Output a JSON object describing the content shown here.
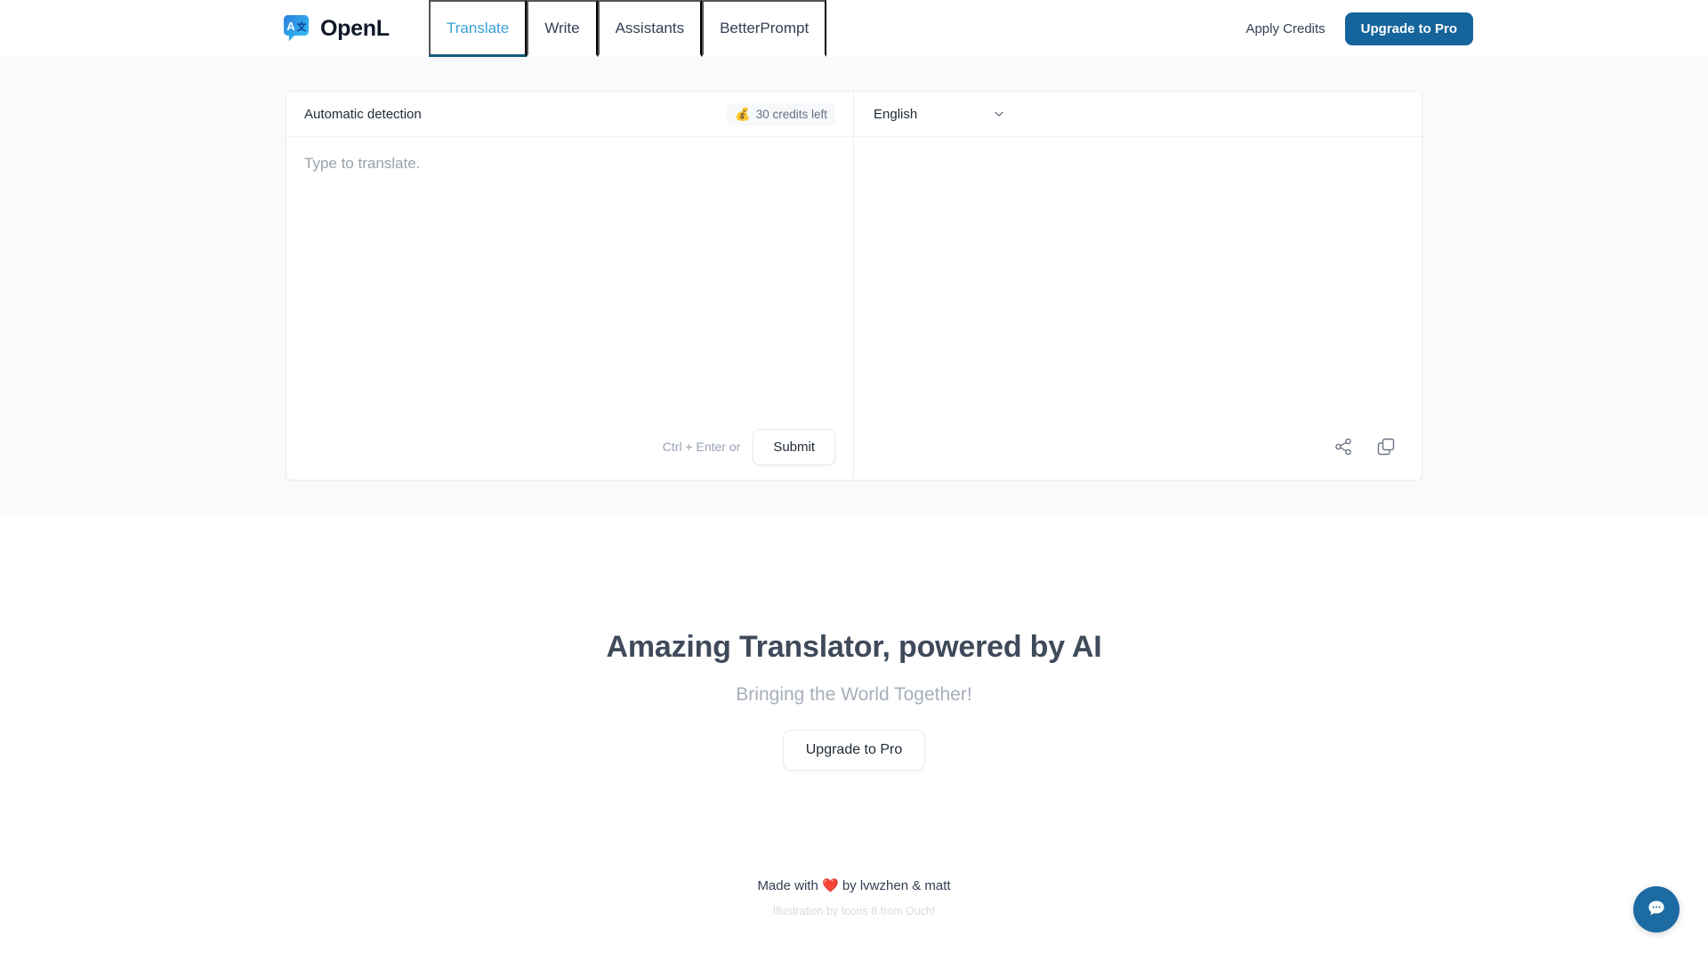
{
  "header": {
    "brand_name": "OpenL",
    "logo_letters": {
      "left": "A",
      "right": "文"
    },
    "nav": [
      {
        "label": "Translate",
        "active": true
      },
      {
        "label": "Write",
        "active": false
      },
      {
        "label": "Assistants",
        "active": false
      },
      {
        "label": "BetterPrompt",
        "active": false
      }
    ],
    "apply_credits_label": "Apply Credits",
    "upgrade_label": "Upgrade to Pro",
    "accent_color": "#3aa0d8",
    "active_underline_color": "#125a7c",
    "primary_button_color": "#15659c"
  },
  "translator": {
    "source": {
      "language_label": "Automatic detection",
      "credits_badge": {
        "emoji": "💰",
        "text": "30 credits left"
      },
      "input_value": "",
      "input_placeholder": "Type to translate.",
      "hint": "Ctrl + Enter or",
      "submit_label": "Submit"
    },
    "target": {
      "language_label": "English",
      "output_value": "",
      "share_icon": "share-icon",
      "copy_icon": "copy-icon"
    }
  },
  "hero": {
    "title": "Amazing Translator, powered by AI",
    "subtitle": "Bringing the World Together!",
    "cta_label": "Upgrade to Pro"
  },
  "footer": {
    "made_prefix": "Made with ",
    "heart": "❤️",
    "made_suffix": " by lvwzhen & matt",
    "illustration_credit": "Illustration by Icons 8 from Ouch!"
  },
  "chat": {
    "icon": "chat-bubble-icon",
    "color": "#1d6ba3"
  }
}
